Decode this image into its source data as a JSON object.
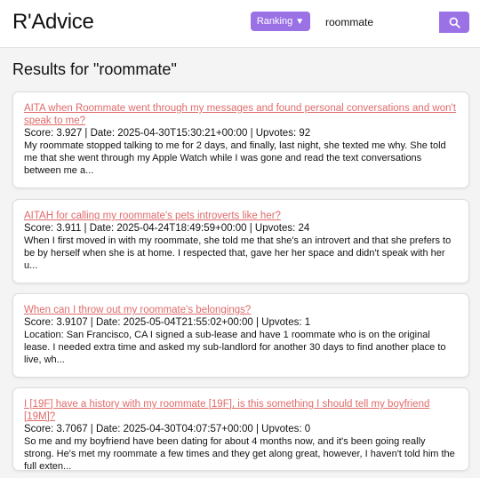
{
  "app": {
    "title": "R'Advice"
  },
  "toolbar": {
    "ranking_label": "Ranking",
    "ranking_caret": "▼"
  },
  "search": {
    "value": "roommate",
    "placeholder": ""
  },
  "results": {
    "heading": "Results for \"roommate\"",
    "items": [
      {
        "title": "AITA when Roommate went through my messages and found personal conversations and won't speak to me?",
        "meta": "Score: 3.927 | Date: 2025-04-30T15:30:21+00:00 | Upvotes: 92",
        "snippet": "My roommate stopped talking to me for 2 days, and finally, last night, she texted me why. She told me that she went through my Apple Watch while I was gone and read the text conversations between me a..."
      },
      {
        "title": "AITAH for calling my roommate's pets introverts like her?",
        "meta": "Score: 3.911 | Date: 2025-04-24T18:49:59+00:00 | Upvotes: 24",
        "snippet": "When I first moved in with my roommate, she told me that she's an introvert and that she prefers to be by herself when she is at home. I respected that, gave her her space and didn't speak with her u..."
      },
      {
        "title": "When can I throw out my roommate's belongings?",
        "meta": "Score: 3.9107 | Date: 2025-05-04T21:55:02+00:00 | Upvotes: 1",
        "snippet": "Location: San Francisco, CA I signed a sub-lease and have 1 roommate who is on the original lease. I needed extra time and asked my sub-landlord for another 30 days to find another place to live, wh..."
      },
      {
        "title": "I [19F] have a history with my roommate [19F], is this something I should tell my boyfriend [19M]?",
        "meta": "Score: 3.7067 | Date: 2025-04-30T04:07:57+00:00 | Upvotes: 0",
        "snippet": "So me and my boyfriend have been dating for about 4 months now, and it's been going really strong. He's met my roommate a few times and they get along great, however, I haven't told him the full exten..."
      }
    ]
  },
  "icons": {
    "search": "search-icon",
    "caret": "caret-down-icon"
  },
  "colors": {
    "accent": "#9b72e6",
    "link": "#e06a6a"
  }
}
